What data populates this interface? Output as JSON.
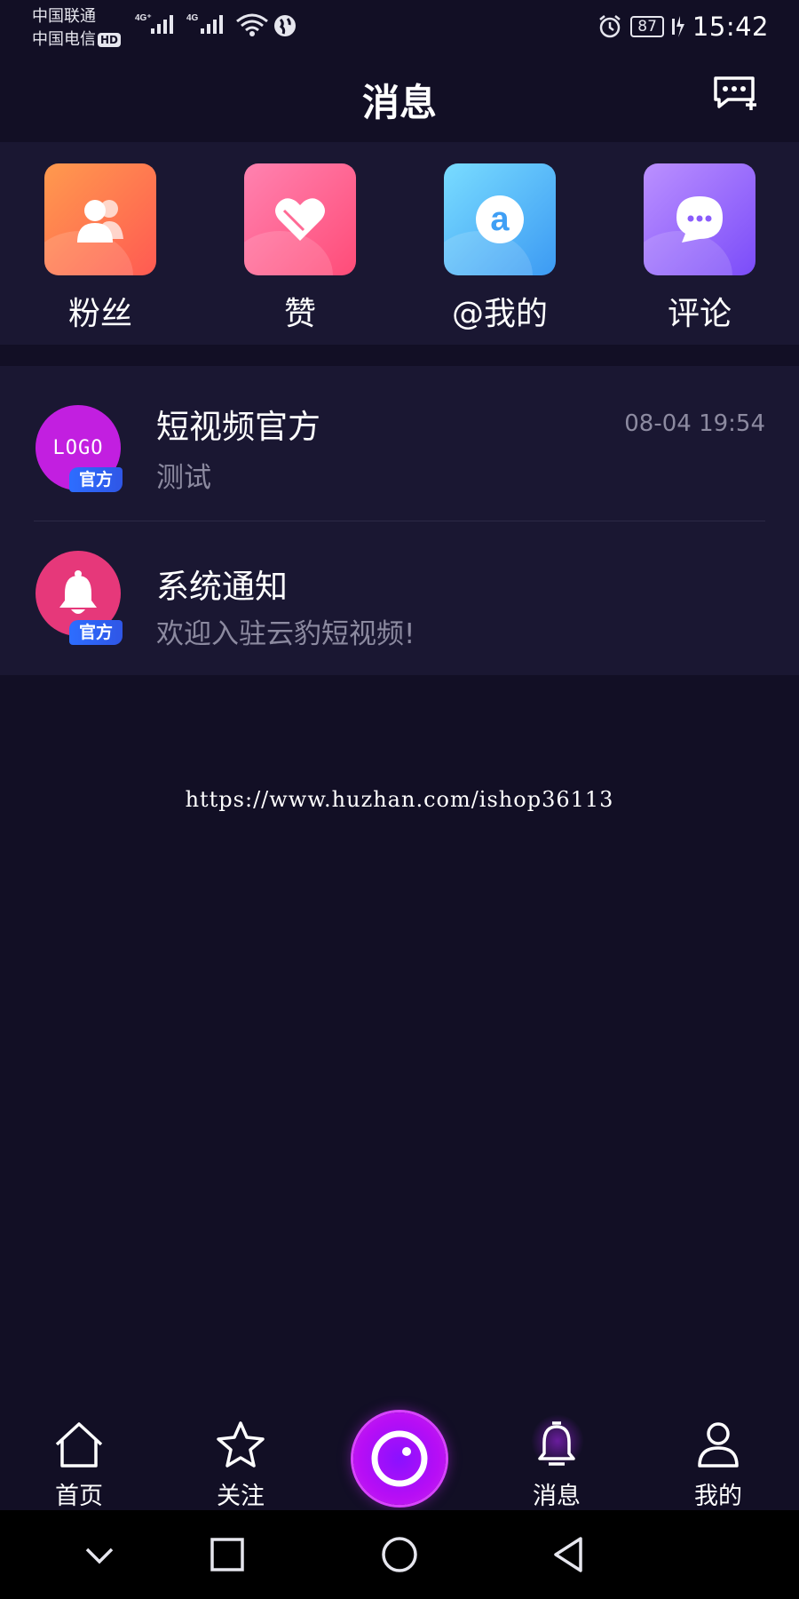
{
  "status_bar": {
    "carrier_1": "中国联通",
    "carrier_2": "中国电信",
    "hd_badge": "HD",
    "signal_1_type": "4G⁺",
    "signal_2_type": "4G",
    "battery_level": "87",
    "time": "15:42"
  },
  "header": {
    "title": "消息"
  },
  "categories": [
    {
      "label": "粉丝",
      "icon": "fans-icon",
      "color_from": "#ff8c4a",
      "color_to": "#ff5e52"
    },
    {
      "label": "赞",
      "icon": "heart-icon",
      "color_from": "#ff79a8",
      "color_to": "#ff4d7a"
    },
    {
      "label": "@我的",
      "icon": "at-icon",
      "color_from": "#6fd6ff",
      "color_to": "#3b9cf5"
    },
    {
      "label": "评论",
      "icon": "comment-icon",
      "color_from": "#b58bff",
      "color_to": "#7c4dfa"
    }
  ],
  "messages": [
    {
      "name": "短视频官方",
      "preview": "测试",
      "time": "08-04 19:54",
      "avatar_text": "LOGO",
      "badge": "官方"
    },
    {
      "name": "系统通知",
      "preview": "欢迎入驻云豹短视频!",
      "time": "",
      "avatar_icon": "bell-icon",
      "badge": "官方"
    }
  ],
  "watermark": "https://www.huzhan.com/ishop36113",
  "tabbar": {
    "home": "首页",
    "follow": "关注",
    "messages": "消息",
    "me": "我的",
    "active": "messages"
  },
  "colors": {
    "background": "#120f25",
    "panel": "#1a1732",
    "accent_purple": "#b70ef5",
    "badge_blue": "#2d6dff"
  }
}
